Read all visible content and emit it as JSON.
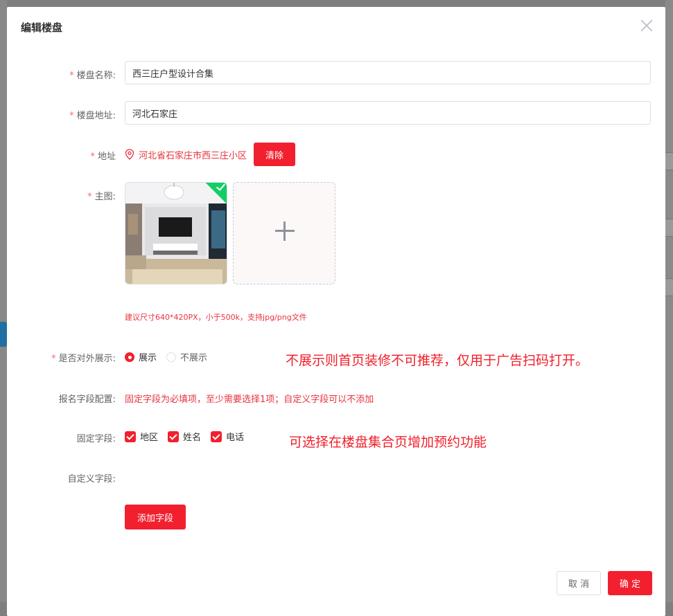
{
  "dialog": {
    "title": "编辑楼盘"
  },
  "form": {
    "name_label": "楼盘名称:",
    "name_value": "西三庄户型设计合集",
    "address_label": "楼盘地址:",
    "address_value": "河北石家庄",
    "location_label": "地址",
    "location_value": "河北省石家庄市西三庄小区",
    "clear_label": "清除",
    "image_label": "主图:",
    "image_hint": "建议尺寸640*420PX，小于500k，支持jpg/png文件",
    "display_label": "是否对外展示:",
    "display_options": [
      "展示",
      "不展示"
    ],
    "display_selected": "展示",
    "signup_label": "报名字段配置:",
    "signup_note": "固定字段为必填项，至少需要选择1项；自定义字段可以不添加",
    "fixed_label": "固定字段:",
    "fixed_fields": [
      "地区",
      "姓名",
      "电话"
    ],
    "custom_label": "自定义字段:",
    "add_field_label": "添加字段",
    "required_mark": "*"
  },
  "annotations": {
    "display_note": "不展示则首页装修不可推荐，仅用于广告扫码打开。",
    "fixed_note": "可选择在楼盘集合页增加预约功能"
  },
  "footer": {
    "cancel_label": "取 消",
    "ok_label": "确 定"
  },
  "colors": {
    "accent": "#f2202f",
    "success": "#13ce66",
    "annotation": "#f0202a"
  }
}
